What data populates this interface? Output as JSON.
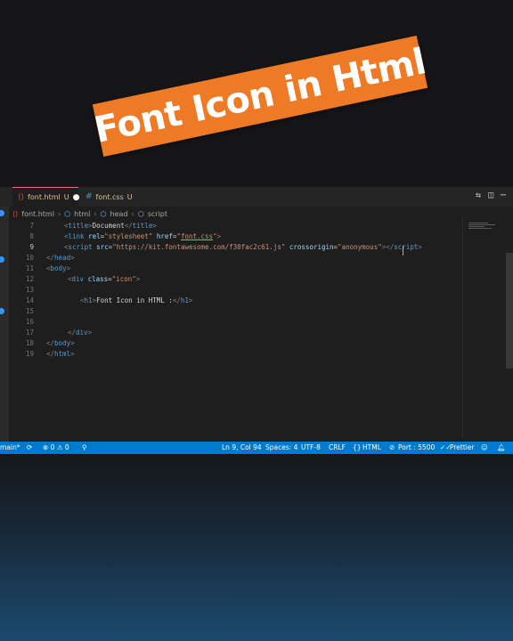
{
  "banner": {
    "text": "Font Icon in Html"
  },
  "tabs": [
    {
      "icon": "⟨⟩",
      "label": "font.html",
      "status": "U",
      "unsaved": "●"
    },
    {
      "icon": "#",
      "label": "font.css",
      "status": "U"
    }
  ],
  "breadcrumb": [
    "font.html",
    "html",
    "head",
    "script"
  ],
  "gutter": [
    "7",
    "8",
    "9",
    "10",
    "11",
    "12",
    "13",
    "14",
    "15",
    "16",
    "17",
    "18",
    "19"
  ],
  "code": {
    "line7": {
      "open": "<",
      "tag": "title",
      "close": ">",
      "text": "Document",
      "endopen": "</",
      "endtag": "title",
      "endclose": ">"
    },
    "line8": {
      "open": "<",
      "tag": "link",
      "a1": "rel",
      "eq1": "=",
      "v1": "\"stylesheet\"",
      "a2": "href",
      "eq2": "=",
      "v2q": "\"",
      "v2": "font.css",
      "v2q2": "\"",
      "close": ">"
    },
    "line9": {
      "open": "<",
      "tag": "script",
      "a1": "src",
      "eq1": "=",
      "v1": "\"https://kit.fontawesome.com/f30fac2c61.js\"",
      "a2": "crossorigin",
      "eq2": "=",
      "v2": "\"anonymous\"",
      "close": ">",
      "endopen": "</",
      "endtag": "script",
      "endclose": ">"
    },
    "line10": {
      "open": "</",
      "tag": "head",
      "close": ">"
    },
    "line11": {
      "open": "<",
      "tag": "body",
      "close": ">"
    },
    "line12": {
      "open": "<",
      "tag": "div",
      "a1": "class",
      "eq1": "=",
      "v1": "\"icon\"",
      "close": ">"
    },
    "line14": {
      "open": "<",
      "tag": "h1",
      "close": ">",
      "text": "Font Icon in HTML :",
      "endopen": "</",
      "endtag": "h1",
      "endclose": ">"
    },
    "line17": {
      "open": "</",
      "tag": "div",
      "close": ">"
    },
    "line18": {
      "open": "</",
      "tag": "body",
      "close": ">"
    },
    "line19": {
      "open": "</",
      "tag": "html",
      "close": ">"
    }
  },
  "status": {
    "branch": "main*",
    "sync": "⟳",
    "problems": "⊗ 0 ⚠ 0",
    "position": "Ln 9, Col 94",
    "spaces": "Spaces: 4",
    "encoding": "UTF-8",
    "eol": "CRLF",
    "language": "HTML",
    "port": "Port : 5500",
    "formatter": "Prettier"
  },
  "colors": {
    "banner": "#ee7a25",
    "statusbar": "#007acc",
    "editor_bg": "#1e1e1e"
  }
}
